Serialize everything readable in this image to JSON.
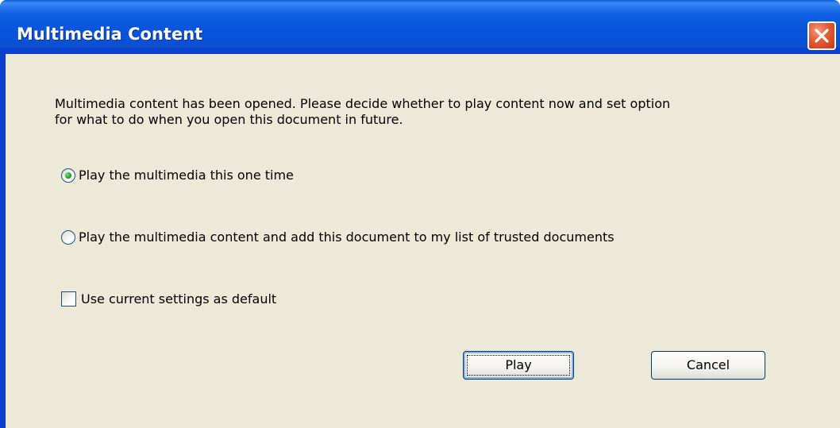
{
  "dialog": {
    "title": "Multimedia Content",
    "message_line1": "Multimedia content has been opened.  Please decide whether to play content now and set  option",
    "message_line2": "for what to do when you open this document in future."
  },
  "options": [
    {
      "label": "Play the multimedia this one time",
      "selected": true
    },
    {
      "label": "Play the multimedia content  and add this document to my  list of trusted documents",
      "selected": false
    }
  ],
  "default_checkbox": {
    "label": "Use current settings as default",
    "checked": false
  },
  "buttons": {
    "play_label": "Play",
    "cancel_label": "Cancel"
  },
  "icons": {
    "close": "close-icon"
  },
  "colors": {
    "titlebar": "#0a56dc",
    "client_bg": "#ece9d8",
    "close_button": "#e25a32",
    "radio_selected": "#21a121"
  }
}
